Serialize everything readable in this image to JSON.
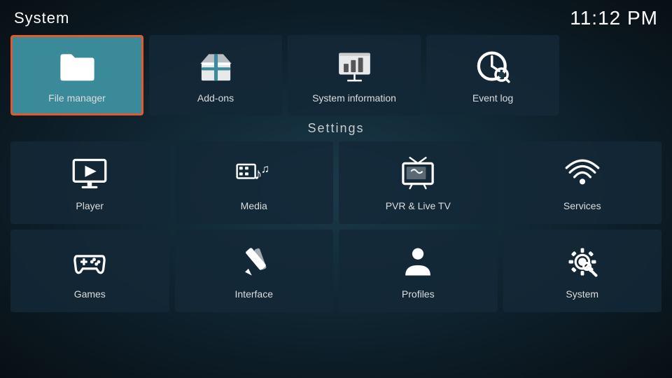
{
  "header": {
    "title": "System",
    "clock": "11:12 PM"
  },
  "top_row": [
    {
      "id": "file-manager",
      "label": "File manager",
      "selected": true
    },
    {
      "id": "add-ons",
      "label": "Add-ons",
      "selected": false
    },
    {
      "id": "system-information",
      "label": "System information",
      "selected": false
    },
    {
      "id": "event-log",
      "label": "Event log",
      "selected": false
    }
  ],
  "settings_section": {
    "label": "Settings"
  },
  "settings_tiles": [
    {
      "id": "player",
      "label": "Player"
    },
    {
      "id": "media",
      "label": "Media"
    },
    {
      "id": "pvr-live-tv",
      "label": "PVR & Live TV"
    },
    {
      "id": "services",
      "label": "Services"
    },
    {
      "id": "games",
      "label": "Games"
    },
    {
      "id": "interface",
      "label": "Interface"
    },
    {
      "id": "profiles",
      "label": "Profiles"
    },
    {
      "id": "system",
      "label": "System"
    }
  ],
  "colors": {
    "selected_bg": "#3a8a9a",
    "selected_border": "#e05a30",
    "tile_bg": "rgba(20,40,55,0.85)"
  }
}
